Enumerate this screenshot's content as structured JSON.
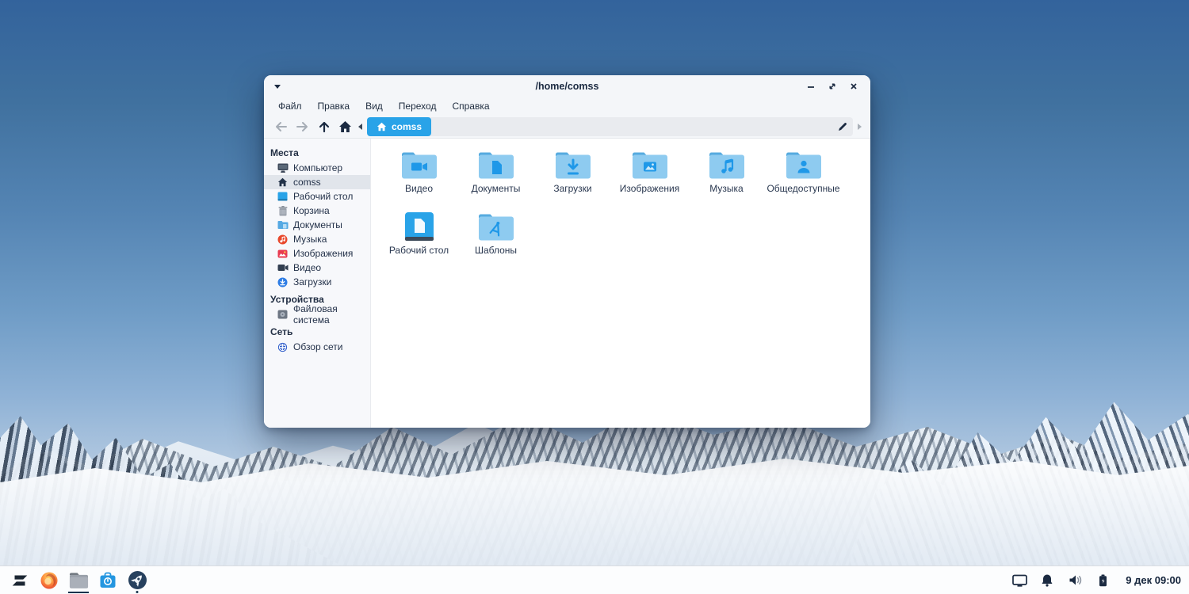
{
  "colors": {
    "accent_blue": "#29a3e8",
    "folder_body": "#8ecbf0",
    "folder_tab": "#56abdf",
    "folder_glyph": "#1f98e8",
    "text_dark": "#1b2a41",
    "selection_gray": "#e1e5eb"
  },
  "window": {
    "title": "/home/comss",
    "menu": {
      "items": [
        "Файл",
        "Правка",
        "Вид",
        "Переход",
        "Справка"
      ]
    },
    "breadcrumb": {
      "current": "comss"
    },
    "sidebar": {
      "sections": [
        {
          "title": "Места",
          "items": [
            {
              "label": "Компьютер",
              "icon": "computer-icon"
            },
            {
              "label": "comss",
              "icon": "home-icon",
              "selected": true
            },
            {
              "label": "Рабочий стол",
              "icon": "desktop-icon"
            },
            {
              "label": "Корзина",
              "icon": "trash-icon"
            },
            {
              "label": "Документы",
              "icon": "documents-folder-icon"
            },
            {
              "label": "Музыка",
              "icon": "music-icon"
            },
            {
              "label": "Изображения",
              "icon": "images-icon"
            },
            {
              "label": "Видео",
              "icon": "video-camera-icon"
            },
            {
              "label": "Загрузки",
              "icon": "downloads-icon"
            }
          ]
        },
        {
          "title": "Устройства",
          "items": [
            {
              "label": "Файловая система",
              "icon": "filesystem-drive-icon"
            }
          ]
        },
        {
          "title": "Сеть",
          "items": [
            {
              "label": "Обзор сети",
              "icon": "network-globe-icon"
            }
          ]
        }
      ]
    },
    "files": {
      "items": [
        {
          "label": "Видео",
          "icon": "folder-video-icon"
        },
        {
          "label": "Документы",
          "icon": "folder-documents-icon"
        },
        {
          "label": "Загрузки",
          "icon": "folder-downloads-icon"
        },
        {
          "label": "Изображения",
          "icon": "folder-images-icon"
        },
        {
          "label": "Музыка",
          "icon": "folder-music-icon"
        },
        {
          "label": "Общедоступные",
          "icon": "folder-public-icon"
        },
        {
          "label": "Рабочий стол",
          "icon": "desktop-folder-icon"
        },
        {
          "label": "Шаблоны",
          "icon": "folder-templates-icon"
        }
      ]
    }
  },
  "taskbar": {
    "apps": [
      {
        "name": "zorin-menu"
      },
      {
        "name": "firefox"
      },
      {
        "name": "file-manager",
        "active": true
      },
      {
        "name": "software-store"
      },
      {
        "name": "launcher-rocket",
        "running": true
      }
    ],
    "tray": [
      "display-icon",
      "notifications-bell-icon",
      "volume-icon",
      "battery-icon"
    ],
    "clock": "9 дек 09:00"
  }
}
